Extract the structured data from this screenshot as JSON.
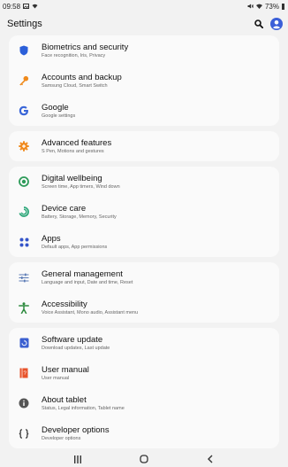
{
  "status": {
    "time": "09:58",
    "battery": "73%"
  },
  "appbar": {
    "title": "Settings"
  },
  "groups": [
    {
      "items": [
        {
          "title": "Biometrics and security",
          "subtitle": "Face recognition, Iris, Privacy",
          "icon": "shield-icon",
          "color": "#2b5fd9"
        },
        {
          "title": "Accounts and backup",
          "subtitle": "Samsung Cloud, Smart Switch",
          "icon": "key-icon",
          "color": "#ef8a1c"
        },
        {
          "title": "Google",
          "subtitle": "Google settings",
          "icon": "google-icon",
          "color": "#3a66d8"
        }
      ]
    },
    {
      "items": [
        {
          "title": "Advanced features",
          "subtitle": "S Pen, Motions and gestures",
          "icon": "gear-plus-icon",
          "color": "#f08a1e"
        }
      ]
    },
    {
      "items": [
        {
          "title": "Digital wellbeing",
          "subtitle": "Screen time, App timers, Wind down",
          "icon": "wellbeing-icon",
          "color": "#2e9b5a"
        },
        {
          "title": "Device care",
          "subtitle": "Battery, Storage, Memory, Security",
          "icon": "device-care-icon",
          "color": "#2ea77a"
        },
        {
          "title": "Apps",
          "subtitle": "Default apps, App permissions",
          "icon": "apps-grid-icon",
          "color": "#3555c9"
        }
      ]
    },
    {
      "items": [
        {
          "title": "General management",
          "subtitle": "Language and input, Date and time, Reset",
          "icon": "sliders-icon",
          "color": "#5a7bb5"
        },
        {
          "title": "Accessibility",
          "subtitle": "Voice Assistant, Mono audio, Assistant menu",
          "icon": "accessibility-icon",
          "color": "#2d8a3e"
        }
      ]
    },
    {
      "items": [
        {
          "title": "Software update",
          "subtitle": "Download updates, Last update",
          "icon": "software-update-icon",
          "color": "#3a5fd0"
        },
        {
          "title": "User manual",
          "subtitle": "User manual",
          "icon": "manual-icon",
          "color": "#e8542c"
        },
        {
          "title": "About tablet",
          "subtitle": "Status, Legal information, Tablet name",
          "icon": "info-icon",
          "color": "#555555"
        },
        {
          "title": "Developer options",
          "subtitle": "Developer options",
          "icon": "code-braces-icon",
          "color": "#333333"
        }
      ]
    }
  ]
}
